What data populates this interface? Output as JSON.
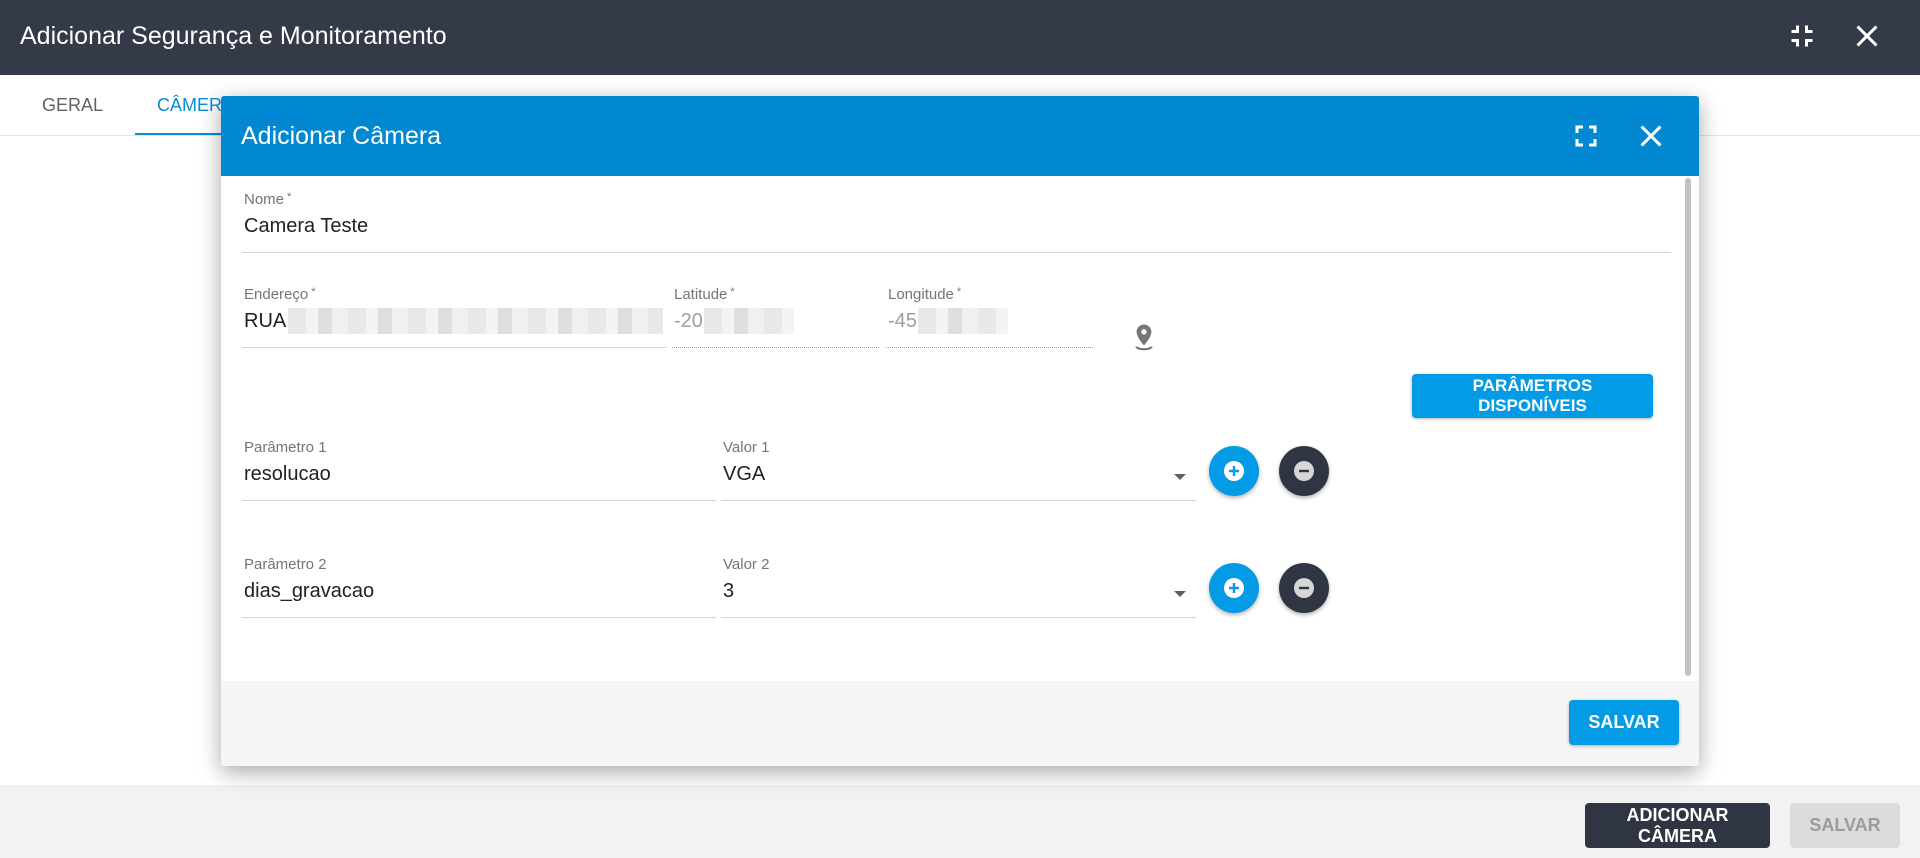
{
  "window": {
    "title": "Adicionar Segurança e Monitoramento",
    "tabs": [
      {
        "label": "GERAL",
        "active": false
      },
      {
        "label": "CÂMERA",
        "active": true
      }
    ],
    "footer": {
      "add_camera_label": "ADICIONAR CÂMERA",
      "save_label": "SALVAR"
    },
    "header_icons": [
      "exit-fullscreen-icon",
      "close-icon"
    ]
  },
  "modal": {
    "title": "Adicionar Câmera",
    "header_icons": [
      "fullscreen-icon",
      "close-icon"
    ],
    "fields": {
      "nome": {
        "label": "Nome",
        "required": "*",
        "value": "Camera Teste"
      },
      "endereco": {
        "label": "Endereço",
        "required": "*",
        "value": "RUA"
      },
      "latitude": {
        "label": "Latitude",
        "required": "*",
        "value": "-20"
      },
      "longitude": {
        "label": "Longitude",
        "required": "*",
        "value": "-45"
      }
    },
    "map_icon": "map-pin-icon",
    "params_button_label": "PARÂMETROS DISPONÍVEIS",
    "parameters": [
      {
        "param_label": "Parâmetro 1",
        "param_value": "resolucao",
        "value_label": "Valor 1",
        "value": "VGA"
      },
      {
        "param_label": "Parâmetro 2",
        "param_value": "dias_gravacao",
        "value_label": "Valor 2",
        "value": "3"
      }
    ],
    "save_label": "SALVAR"
  },
  "colors": {
    "header_dark": "#343a48",
    "modal_header": "#0288d1",
    "primary": "#039be5",
    "dark_button": "#2f3542"
  }
}
